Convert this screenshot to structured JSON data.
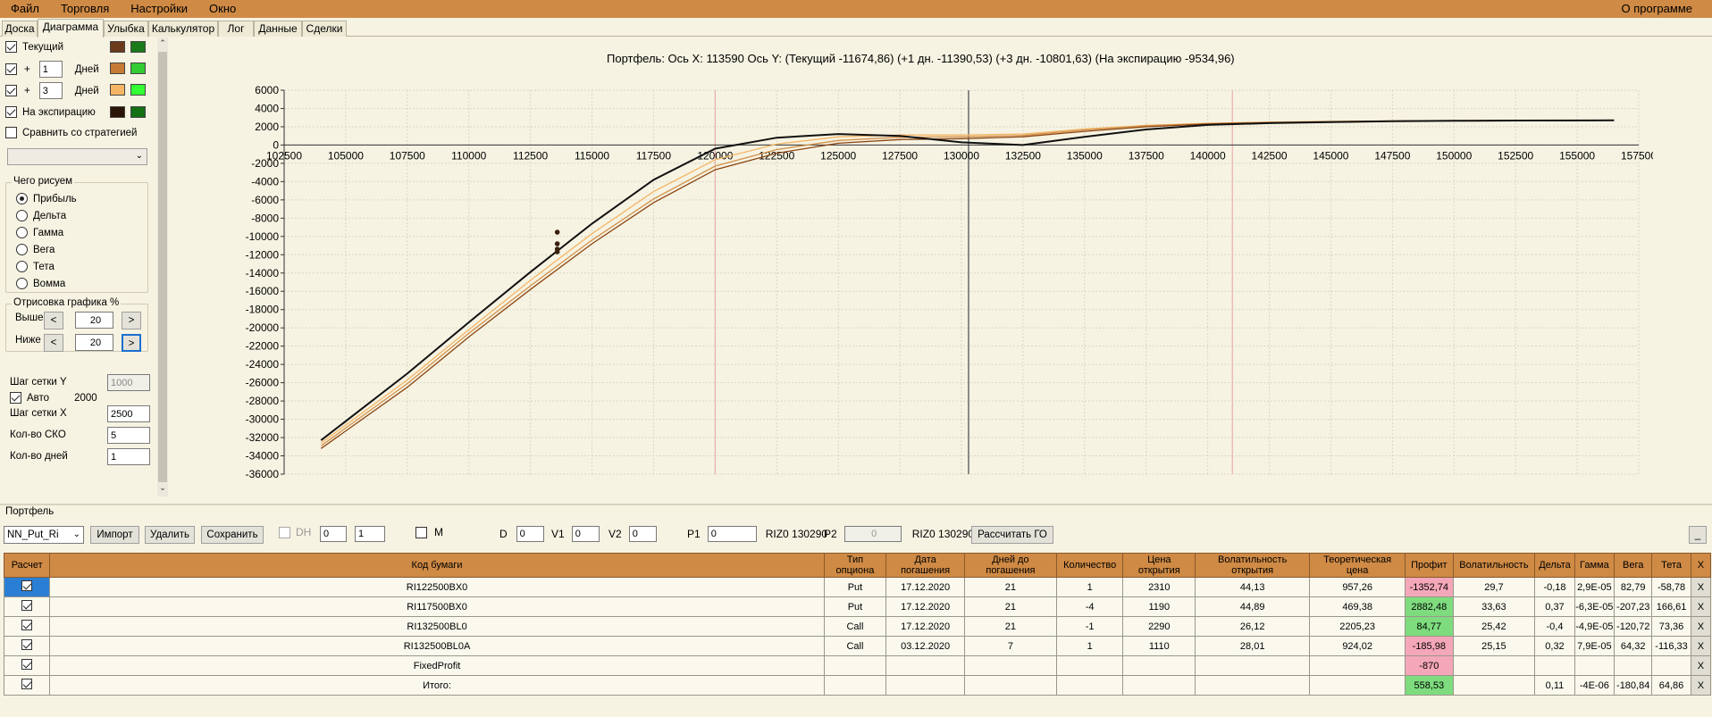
{
  "menu": {
    "file": "Файл",
    "trade": "Торговля",
    "settings": "Настройки",
    "window": "Окно",
    "about": "О программе"
  },
  "tabs": [
    "Доска",
    "Диаграмма",
    "Улыбка",
    "Калькулятор",
    "Лог",
    "Данные",
    "Сделки"
  ],
  "left": {
    "current": "Текущий",
    "plus": "+",
    "days": "Дней",
    "days1": "1",
    "days2": "3",
    "expiry": "На экспирацию",
    "compare": "Сравнить со стратегией",
    "what_title": "Чего рисуем",
    "radios": [
      "Прибыль",
      "Дельта",
      "Гамма",
      "Вега",
      "Тета",
      "Вомма"
    ],
    "draw_title": "Отрисовка графика %",
    "above": "Выше",
    "below": "Ниже",
    "above_val": "20",
    "below_val": "20",
    "lt": "<",
    "gt": ">",
    "grid_y": "Шаг сетки Y",
    "grid_y_val": "1000",
    "auto": "Авто",
    "auto_val": "2000",
    "grid_x": "Шаг сетки X",
    "grid_x_val": "2500",
    "sko": "Кол-во СКО",
    "sko_val": "5",
    "days_cnt": "Кол-во дней",
    "days_cnt_val": "1",
    "colors": {
      "cur_dark": "#6b3a1c",
      "cur_green": "#1a7a1a",
      "d1_orange": "#c77a35",
      "d1_green": "#33cc33",
      "d3_peach": "#f5b565",
      "d3_green": "#33ff33",
      "exp_dark": "#2b1508",
      "exp_green": "#157015"
    }
  },
  "chart": {
    "title": "Портфель: Ось X:  113590 Ось Y:  (Текущий -11674,86)  (+1 дн. -11390,53)  (+3 дн. -10801,63)  (На экспирацию -9534,96)"
  },
  "chart_data": {
    "type": "line",
    "xlim": [
      102500,
      157500
    ],
    "ylim": [
      -36000,
      6000
    ],
    "xticks": [
      102500,
      105000,
      107500,
      110000,
      112500,
      115000,
      117500,
      120000,
      122500,
      125000,
      127500,
      130000,
      132500,
      135000,
      137500,
      140000,
      142500,
      145000,
      147500,
      150000,
      152500,
      155000,
      157500
    ],
    "yticks": [
      6000,
      4000,
      2000,
      0,
      -2000,
      -4000,
      -6000,
      -8000,
      -10000,
      -12000,
      -14000,
      -16000,
      -18000,
      -20000,
      -22000,
      -24000,
      -26000,
      -28000,
      -30000,
      -32000,
      -34000,
      -36000
    ],
    "grid": true,
    "vlines_red": [
      120000,
      141000
    ],
    "vline_gray": 130290,
    "marker_x": 113590,
    "series": [
      {
        "color": "#111111",
        "x": [
          104000,
          107500,
          110000,
          112500,
          115000,
          117500,
          120000,
          122500,
          125000,
          127500,
          130000,
          132500,
          135000,
          137500,
          140000,
          142500,
          145000,
          147500,
          150000,
          152500,
          156500
        ],
        "y": [
          -32300,
          -25000,
          -19400,
          -13900,
          -8600,
          -3800,
          -400,
          800,
          1200,
          1000,
          300,
          0,
          900,
          1700,
          2200,
          2400,
          2500,
          2600,
          2650,
          2680,
          2700
        ]
      },
      {
        "color": "#8b4513",
        "x": [
          104000,
          107500,
          110000,
          112500,
          115000,
          117500,
          120000,
          122500,
          125000,
          127500,
          130000,
          132500,
          135000,
          137500,
          140000,
          142500,
          145000,
          147500,
          150000,
          152500,
          156500
        ],
        "y": [
          -33200,
          -26500,
          -21000,
          -15800,
          -10800,
          -6300,
          -2700,
          -900,
          200,
          600,
          700,
          900,
          1500,
          2000,
          2300,
          2450,
          2550,
          2620,
          2660,
          2690,
          2700
        ]
      },
      {
        "color": "#d2914b",
        "x": [
          104000,
          107500,
          110000,
          112500,
          115000,
          117500,
          120000,
          122500,
          125000,
          127500,
          130000,
          132500,
          135000,
          137500,
          140000,
          142500,
          145000,
          147500,
          150000,
          152500,
          156500
        ],
        "y": [
          -32900,
          -26100,
          -20600,
          -15400,
          -10400,
          -5900,
          -2300,
          -500,
          500,
          850,
          900,
          1050,
          1650,
          2100,
          2350,
          2480,
          2570,
          2630,
          2670,
          2695,
          2700
        ]
      },
      {
        "color": "#f5b565",
        "x": [
          104000,
          107500,
          110000,
          112500,
          115000,
          117500,
          120000,
          122500,
          125000,
          127500,
          130000,
          132500,
          135000,
          137500,
          140000,
          142500,
          145000,
          147500,
          150000,
          152500,
          156500
        ],
        "y": [
          -32600,
          -25700,
          -20200,
          -14800,
          -9700,
          -5100,
          -1600,
          100,
          900,
          1100,
          1100,
          1200,
          1750,
          2150,
          2380,
          2500,
          2580,
          2640,
          2675,
          2698,
          2700
        ]
      }
    ],
    "markers": [
      {
        "x": 113590,
        "y": -11675
      },
      {
        "x": 113590,
        "y": -11391
      },
      {
        "x": 113590,
        "y": -10802
      },
      {
        "x": 113590,
        "y": -9535
      }
    ]
  },
  "portfolio": {
    "label": "Портфель",
    "name": "NN_Put_Ri",
    "import": "Импорт",
    "delete": "Удалить",
    "save": "Сохранить",
    "dh": "DH",
    "dh_v1": "0",
    "dh_v2": "1",
    "m": "M",
    "d": "D",
    "d_val": "0",
    "v1": "V1",
    "v1_val": "0",
    "v2": "V2",
    "v2_val": "0",
    "p1": "P1",
    "p1_val": "0",
    "p1_txt": "RIZ0 130290",
    "p2": "P2",
    "p2_val": "0",
    "p2_txt": "RIZ0 130290",
    "calc": "Рассчитать ГО",
    "min": "_"
  },
  "table": {
    "headers": [
      "Расчет",
      "Код бумаги",
      "Тип\nопциона",
      "Дата\nпогашения",
      "Дней до\nпогашения",
      "Количество",
      "Цена\nоткрытия",
      "Волатильность\nоткрытия",
      "Теоретическая\nцена",
      "Профит",
      "Волатильность",
      "Дельта",
      "Гамма",
      "Вега",
      "Тета",
      "X"
    ],
    "rows": [
      [
        "RI122500BX0",
        "Put",
        "17.12.2020",
        "21",
        "1",
        "2310",
        "44,13",
        "957,26",
        "-1352,74",
        "29,7",
        "-0,18",
        "2,9E-05",
        "82,79",
        "-58,78",
        "X"
      ],
      [
        "RI117500BX0",
        "Put",
        "17.12.2020",
        "21",
        "-4",
        "1190",
        "44,89",
        "469,38",
        "2882,48",
        "33,63",
        "0,37",
        "-6,3E-05",
        "-207,23",
        "166,61",
        "X"
      ],
      [
        "RI132500BL0",
        "Call",
        "17.12.2020",
        "21",
        "-1",
        "2290",
        "26,12",
        "2205,23",
        "84,77",
        "25,42",
        "-0,4",
        "-4,9E-05",
        "-120,72",
        "73,36",
        "X"
      ],
      [
        "RI132500BL0A",
        "Call",
        "03.12.2020",
        "7",
        "1",
        "1110",
        "28,01",
        "924,02",
        "-185,98",
        "25,15",
        "0,32",
        "7,9E-05",
        "64,32",
        "-116,33",
        "X"
      ],
      [
        "FixedProfit",
        "",
        "",
        "",
        "",
        "",
        "",
        "",
        "-870",
        "",
        "",
        "",
        "",
        "",
        "X"
      ],
      [
        "Итого:",
        "",
        "",
        "",
        "",
        "",
        "",
        "",
        "558,53",
        "",
        "0,11",
        "-4E-06",
        "-180,84",
        "64,86",
        "X"
      ]
    ]
  }
}
